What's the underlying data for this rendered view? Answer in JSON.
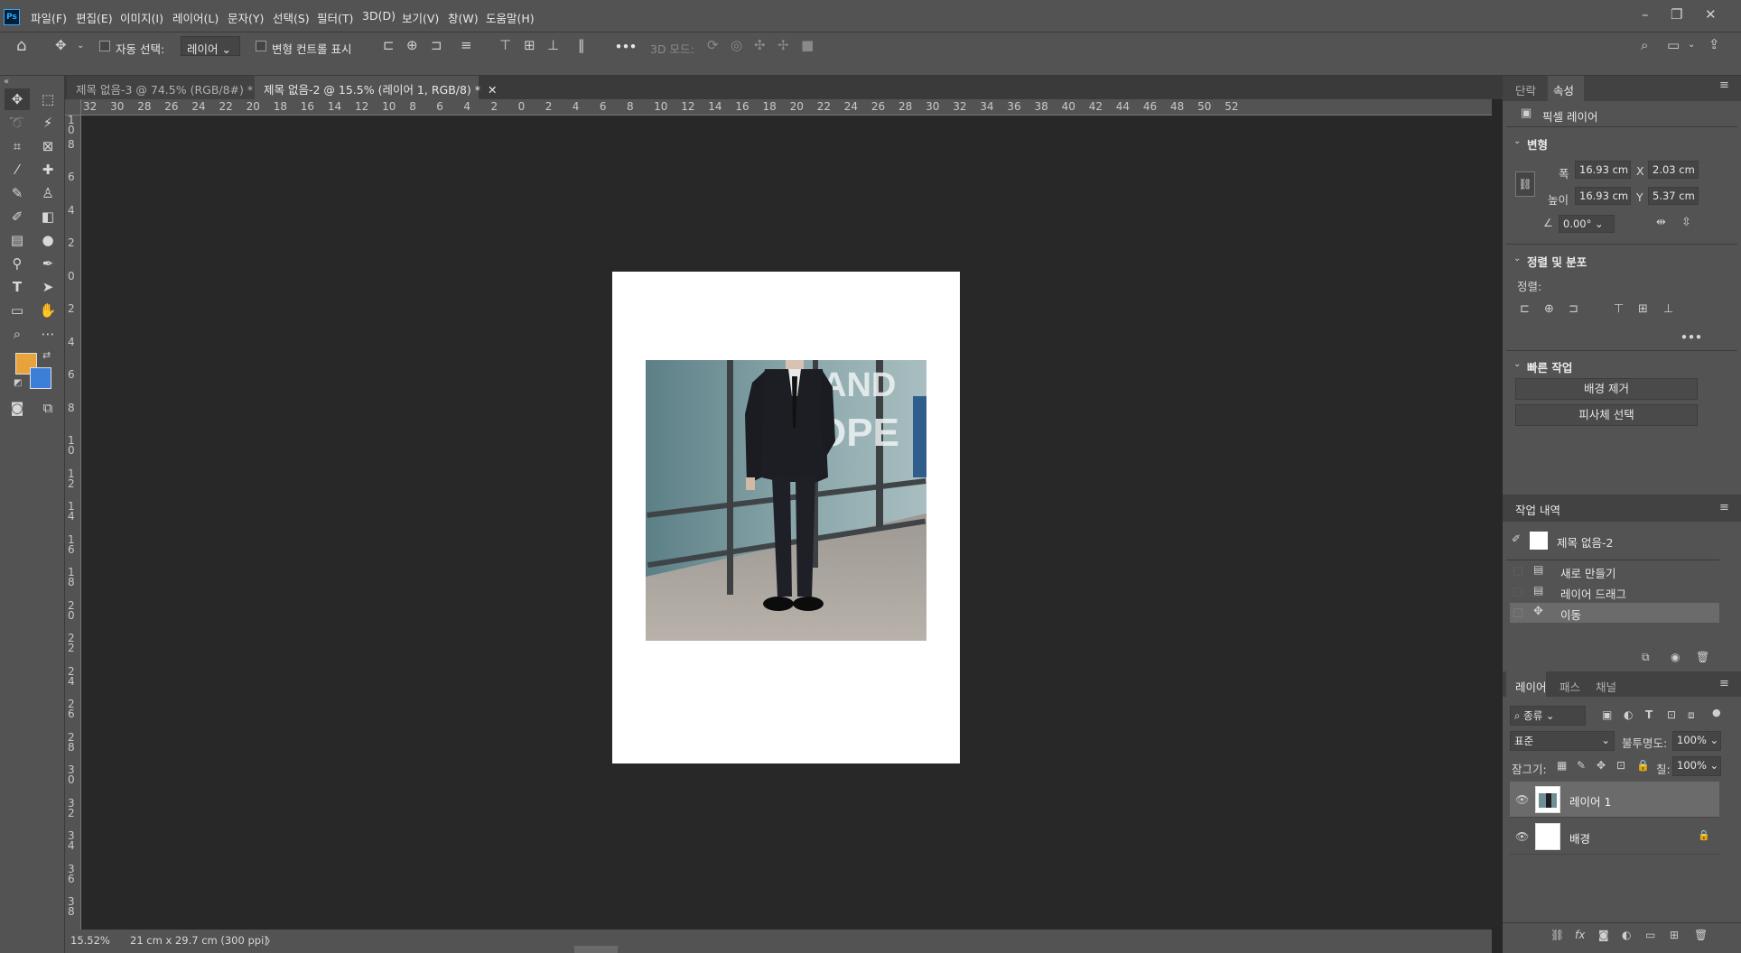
{
  "app": {
    "icon_text": "Ps"
  },
  "menu": [
    "파일(F)",
    "편집(E)",
    "이미지(I)",
    "레이어(L)",
    "문자(Y)",
    "선택(S)",
    "필터(T)",
    "3D(D)",
    "보기(V)",
    "창(W)",
    "도움말(H)"
  ],
  "options_bar": {
    "auto_select_label": "자동 선택:",
    "auto_select_target": "레이어",
    "show_transform_label": "변형 컨트롤 표시",
    "more": "•••",
    "mode_3d_label": "3D 모드:"
  },
  "tabs": [
    {
      "label": "제목 없음-3 @ 74.5% (RGB/8#) *",
      "active": false
    },
    {
      "label": "제목 없음-2 @ 15.5% (레이어 1, RGB/8) *",
      "active": true
    }
  ],
  "rulers": {
    "horizontal": [
      "32",
      "30",
      "28",
      "26",
      "24",
      "22",
      "20",
      "18",
      "16",
      "14",
      "12",
      "10",
      "8",
      "6",
      "4",
      "2",
      "0",
      "2",
      "4",
      "6",
      "8",
      "10",
      "12",
      "14",
      "16",
      "18",
      "20",
      "22",
      "24",
      "26",
      "28",
      "30",
      "32",
      "34",
      "36",
      "38",
      "40",
      "42",
      "44",
      "46",
      "48",
      "50",
      "52"
    ],
    "vertical": [
      "1 0",
      "8",
      "6",
      "4",
      "2",
      "0",
      "2",
      "4",
      "6",
      "8",
      "1 0",
      "1 2",
      "1 4",
      "1 6",
      "1 8",
      "2 0",
      "2 2",
      "2 4",
      "2 6",
      "2 8",
      "3 0",
      "3 2",
      "3 4",
      "3 6",
      "3 8"
    ]
  },
  "colors": {
    "foreground": "#e8a33d",
    "background": "#3b7fd9"
  },
  "status": {
    "zoom": "15.52%",
    "doc_size": "21 cm x 29.7 cm (300 ppi)",
    "arrow": "〉"
  },
  "properties_panel": {
    "tabs": [
      "단락",
      "속성"
    ],
    "layer_type": "픽셀 레이어",
    "transform_title": "변형",
    "width_label": "폭",
    "width_value": "16.93 cm",
    "height_label": "높이",
    "height_value": "16.93 cm",
    "x_label": "X",
    "x_value": "2.03 cm",
    "y_label": "Y",
    "y_value": "5.37 cm",
    "angle_value": "0.00°",
    "align_title": "정렬 및 분포",
    "align_label": "정렬:",
    "more": "•••",
    "quick_title": "빠른 작업",
    "remove_bg": "배경 제거",
    "select_subject": "피사체 선택"
  },
  "history_panel": {
    "title": "작업 내역",
    "snapshot": "제목 없음-2",
    "items": [
      "새로 만들기",
      "레이어 드래그",
      "이동"
    ]
  },
  "layers_panel": {
    "tabs": [
      "레이어",
      "패스",
      "채널"
    ],
    "filter_kind": "종류",
    "blend_mode": "표준",
    "opacity_label": "불투명도:",
    "opacity_value": "100%",
    "lock_label": "잠그기:",
    "fill_label": "칠:",
    "fill_value": "100%",
    "layers": [
      "레이어 1",
      "배경"
    ]
  }
}
